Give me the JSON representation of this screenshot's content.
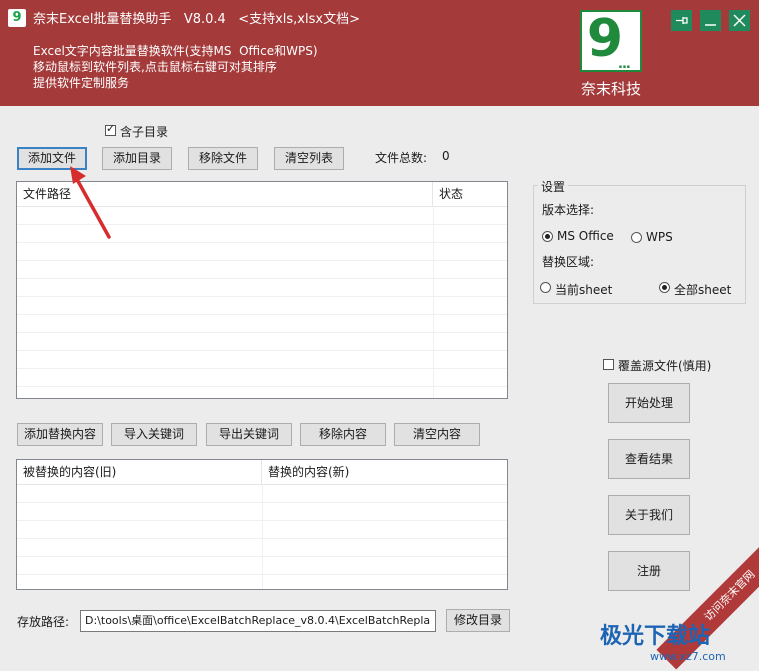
{
  "header": {
    "app_icon": "9",
    "title": "奈末Excel批量替换助手   V8.0.4   <支持xls,xlsx文档>",
    "lines": [
      "Excel文字内容批量替换软件(支持MS  Office和WPS)",
      "移动鼠标到软件列表,点击鼠标右键可对其排序",
      "提供软件定制服务"
    ],
    "logo_digit": "9",
    "logo_dots": "...",
    "logo_text": "奈末科技",
    "pin_icon": "pin-icon",
    "min_icon": "minimize-icon",
    "close_icon": "close-icon"
  },
  "files": {
    "include_subdir_label": "含子目录",
    "include_subdir_checked": true,
    "add_file": "添加文件",
    "add_dir": "添加目录",
    "remove_file": "移除文件",
    "clear_list": "清空列表",
    "total_label": "文件总数:",
    "total_value": "0",
    "columns": [
      "文件路径",
      "状态"
    ]
  },
  "replace": {
    "add_content": "添加替换内容",
    "import_keywords": "导入关键词",
    "export_keywords": "导出关键词",
    "remove_content": "移除内容",
    "clear_content": "清空内容",
    "columns": [
      "被替换的内容(旧)",
      "替换的内容(新)"
    ]
  },
  "settings": {
    "group_title": "设置",
    "version_label": "版本选择:",
    "version_options": [
      "MS Office",
      "WPS"
    ],
    "version_selected": "MS Office",
    "scope_label": "替换区域:",
    "scope_options": [
      "当前sheet",
      "全部sheet"
    ],
    "scope_selected": "全部sheet",
    "overwrite_label": "覆盖源文件(慎用)",
    "overwrite_checked": false
  },
  "actions": {
    "start": "开始处理",
    "view_result": "查看结果",
    "about": "关于我们",
    "register": "注册"
  },
  "output": {
    "label": "存放路径:",
    "path": "D:\\tools\\桌面\\office\\ExcelBatchReplace_v8.0.4\\ExcelBatchRepla",
    "change_dir": "修改目录"
  },
  "overlay": {
    "ribbon": "访问奈末官网",
    "watermark": "极光下载站",
    "watermark_url": "www.xz7.com"
  },
  "colors": {
    "header_bg": "#a43a3a",
    "brand_green": "#1f8a3c",
    "arrow": "#d62d2d"
  }
}
